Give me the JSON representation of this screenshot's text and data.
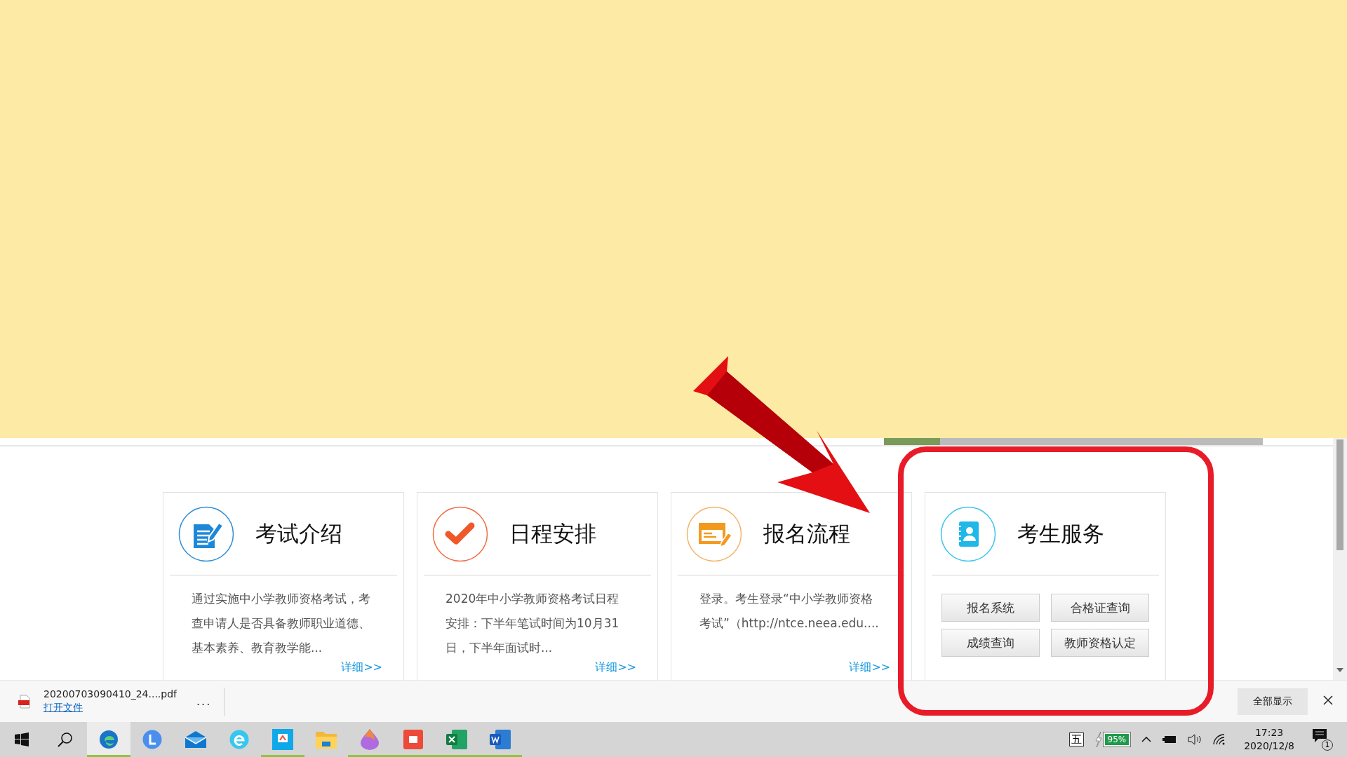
{
  "cards": [
    {
      "kind": "document",
      "title": "考试介绍",
      "body": "通过实施中小学教师资格考试，考查申请人是否具备教师职业道德、基本素养、教育教学能...",
      "link": "详细>>"
    },
    {
      "kind": "check",
      "title": "日程安排",
      "body": "2020年中小学教师资格考试日程安排：下半年笔试时间为10月31日，下半年面试时...",
      "link": "详细>>"
    },
    {
      "kind": "form",
      "title": "报名流程",
      "body": "登录。考生登录“中小学教师资格考试”（http://ntce.neea.edu....",
      "link": "详细>>"
    },
    {
      "kind": "contacts",
      "title": "考生服务",
      "buttons": [
        "报名系统",
        "合格证查询",
        "成绩查询",
        "教师资格认定"
      ]
    }
  ],
  "download_bar": {
    "file_name": "20200703090410_24....pdf",
    "open_link": "打开文件",
    "more": "...",
    "show_all": "全部显示"
  },
  "taskbar": {
    "apps": [
      {
        "kind": "start",
        "running": false,
        "active": false
      },
      {
        "kind": "search",
        "running": false,
        "active": false
      },
      {
        "kind": "edge",
        "running": true,
        "active": true
      },
      {
        "kind": "l-app",
        "running": false,
        "active": false
      },
      {
        "kind": "mail",
        "running": false,
        "active": false
      },
      {
        "kind": "browser",
        "running": false,
        "active": false
      },
      {
        "kind": "blue-app",
        "running": true,
        "active": false
      },
      {
        "kind": "folder",
        "running": false,
        "active": false
      },
      {
        "kind": "drop",
        "running": true,
        "active": false
      },
      {
        "kind": "recorder",
        "running": true,
        "active": false
      },
      {
        "kind": "excel",
        "running": true,
        "active": false
      },
      {
        "kind": "word",
        "running": true,
        "active": false
      }
    ],
    "ime": "五",
    "battery": "95%",
    "time": "17:23",
    "date": "2020/12/8",
    "notifications": "1"
  }
}
